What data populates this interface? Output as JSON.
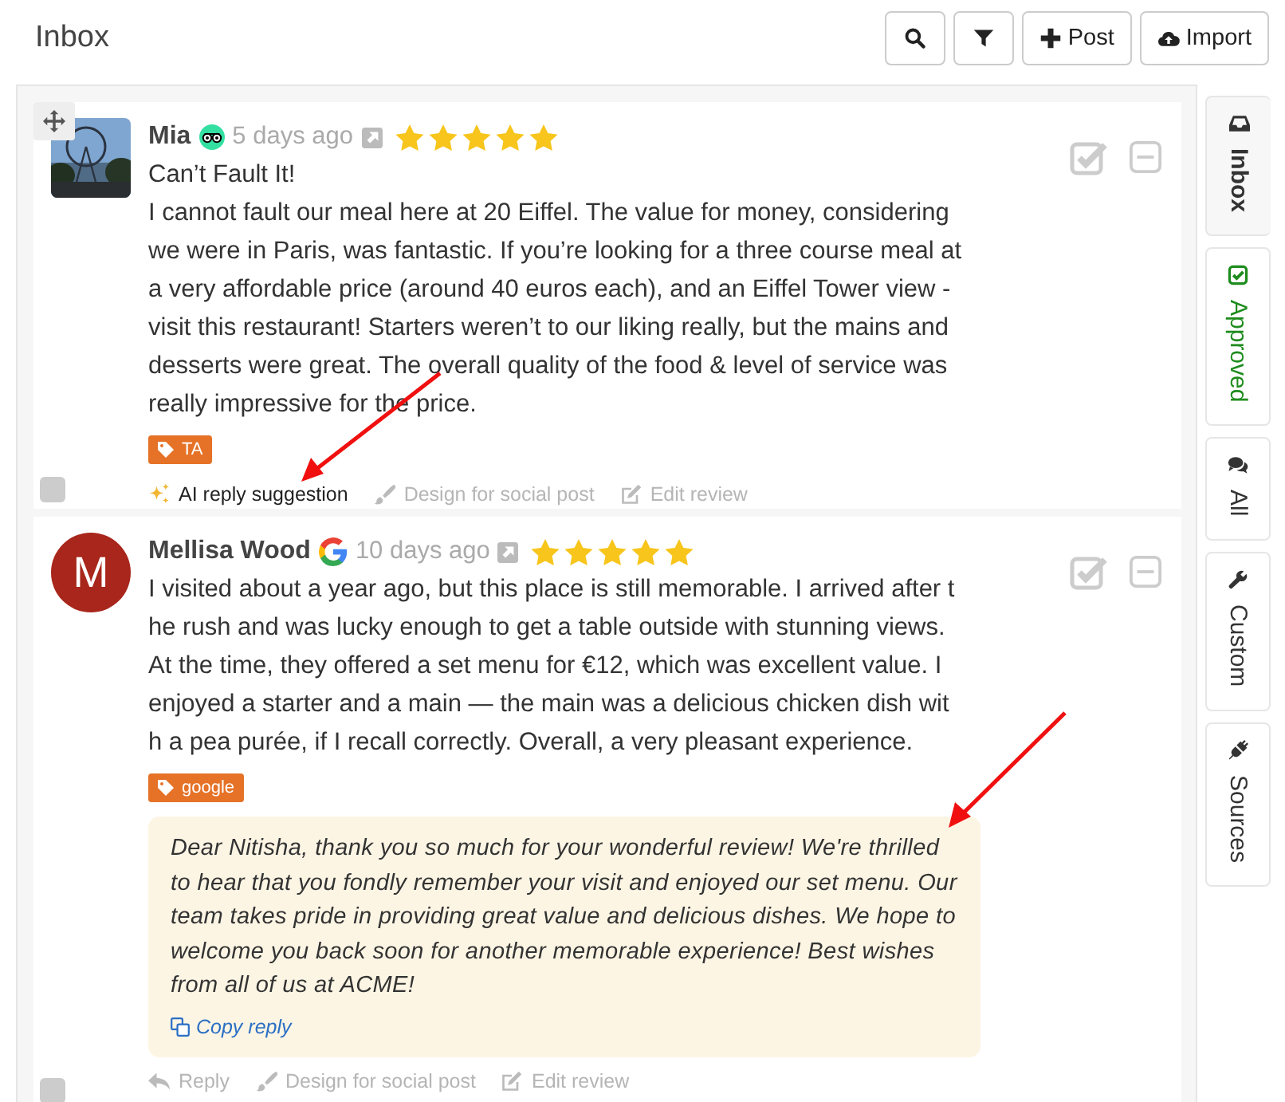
{
  "header": {
    "title": "Inbox"
  },
  "toolbar": [
    {
      "kind": "search"
    },
    {
      "kind": "filter"
    },
    {
      "kind": "plus",
      "label": "Post"
    },
    {
      "kind": "upload",
      "label": "Import"
    }
  ],
  "reviews": [
    {
      "avatar": {
        "kind": "picture"
      },
      "drag_handle": true,
      "author": "Mia",
      "source": {
        "kind": "tripadvisor"
      },
      "selected": false,
      "time": "5 days ago",
      "stars": 5,
      "title": "Can’t Fault It!",
      "body": "I cannot fault our meal here at 20 Eiffel. The value for money, considering we were in Paris, was fantastic. If you’re looking for a three course meal at a very affordable price (around 40 euros each), and an Eiffel Tower view - visit this restaurant! Starters weren’t to our liking really, but the mains and desserts were great. The overall quality of the food & level of service was really impressive for the price.",
      "tag": "TA",
      "actions": [
        {
          "kind": "ai",
          "label": "AI reply suggestion",
          "disabled": false,
          "pointed": true
        },
        {
          "kind": "design",
          "label": "Design for social post",
          "disabled": true,
          "pointed": false
        },
        {
          "kind": "edit",
          "label": "Edit review",
          "disabled": true,
          "pointed": false
        }
      ]
    },
    {
      "avatar": {
        "kind": "letter",
        "letter": "M",
        "color": "#a8261b"
      },
      "drag_handle": false,
      "author": "Mellisa Wood",
      "source": {
        "kind": "google"
      },
      "selected": false,
      "time": "10 days ago",
      "stars": 5,
      "body": "I visited about a year ago, but this place is still memorable. I arrived after the rush and was lucky enough to get a table outside with stunning views. At the time, they offered a set menu for €12, which was excellent value. I enjoyed a starter and a main — the main was a delicious chicken dish with a pea purée, if I recall correctly. Overall, a very pleasant experience.",
      "tag": "google",
      "reply": {
        "text": "Dear Nitisha, thank you so much for your wonderful review! We're thrilled to hear that you fondly remember your visit and enjoyed our set menu. Our team takes pride in providing great value and delicious dishes. We hope to welcome you back soon for another memorable experience! Best wishes from all of us at ACME!",
        "copy_label": "Copy reply",
        "pointed": true
      },
      "actions": [
        {
          "kind": "reply",
          "label": "Reply",
          "disabled": true,
          "pointed": false
        },
        {
          "kind": "design",
          "label": "Design for social post",
          "disabled": true,
          "pointed": false
        },
        {
          "kind": "edit",
          "label": "Edit review",
          "disabled": true,
          "pointed": false
        }
      ]
    }
  ],
  "side_tabs": [
    {
      "kind": "inbox",
      "label": "Inbox",
      "selected": true,
      "color": "#333333"
    },
    {
      "kind": "approved",
      "label": "Approved",
      "selected": false,
      "color": "#1e8c1e"
    },
    {
      "kind": "all",
      "label": "All",
      "selected": false,
      "color": "#333333"
    },
    {
      "kind": "custom",
      "label": "Custom",
      "selected": false,
      "color": "#333333"
    },
    {
      "kind": "sources",
      "label": "Sources",
      "selected": false,
      "color": "#333333"
    }
  ]
}
